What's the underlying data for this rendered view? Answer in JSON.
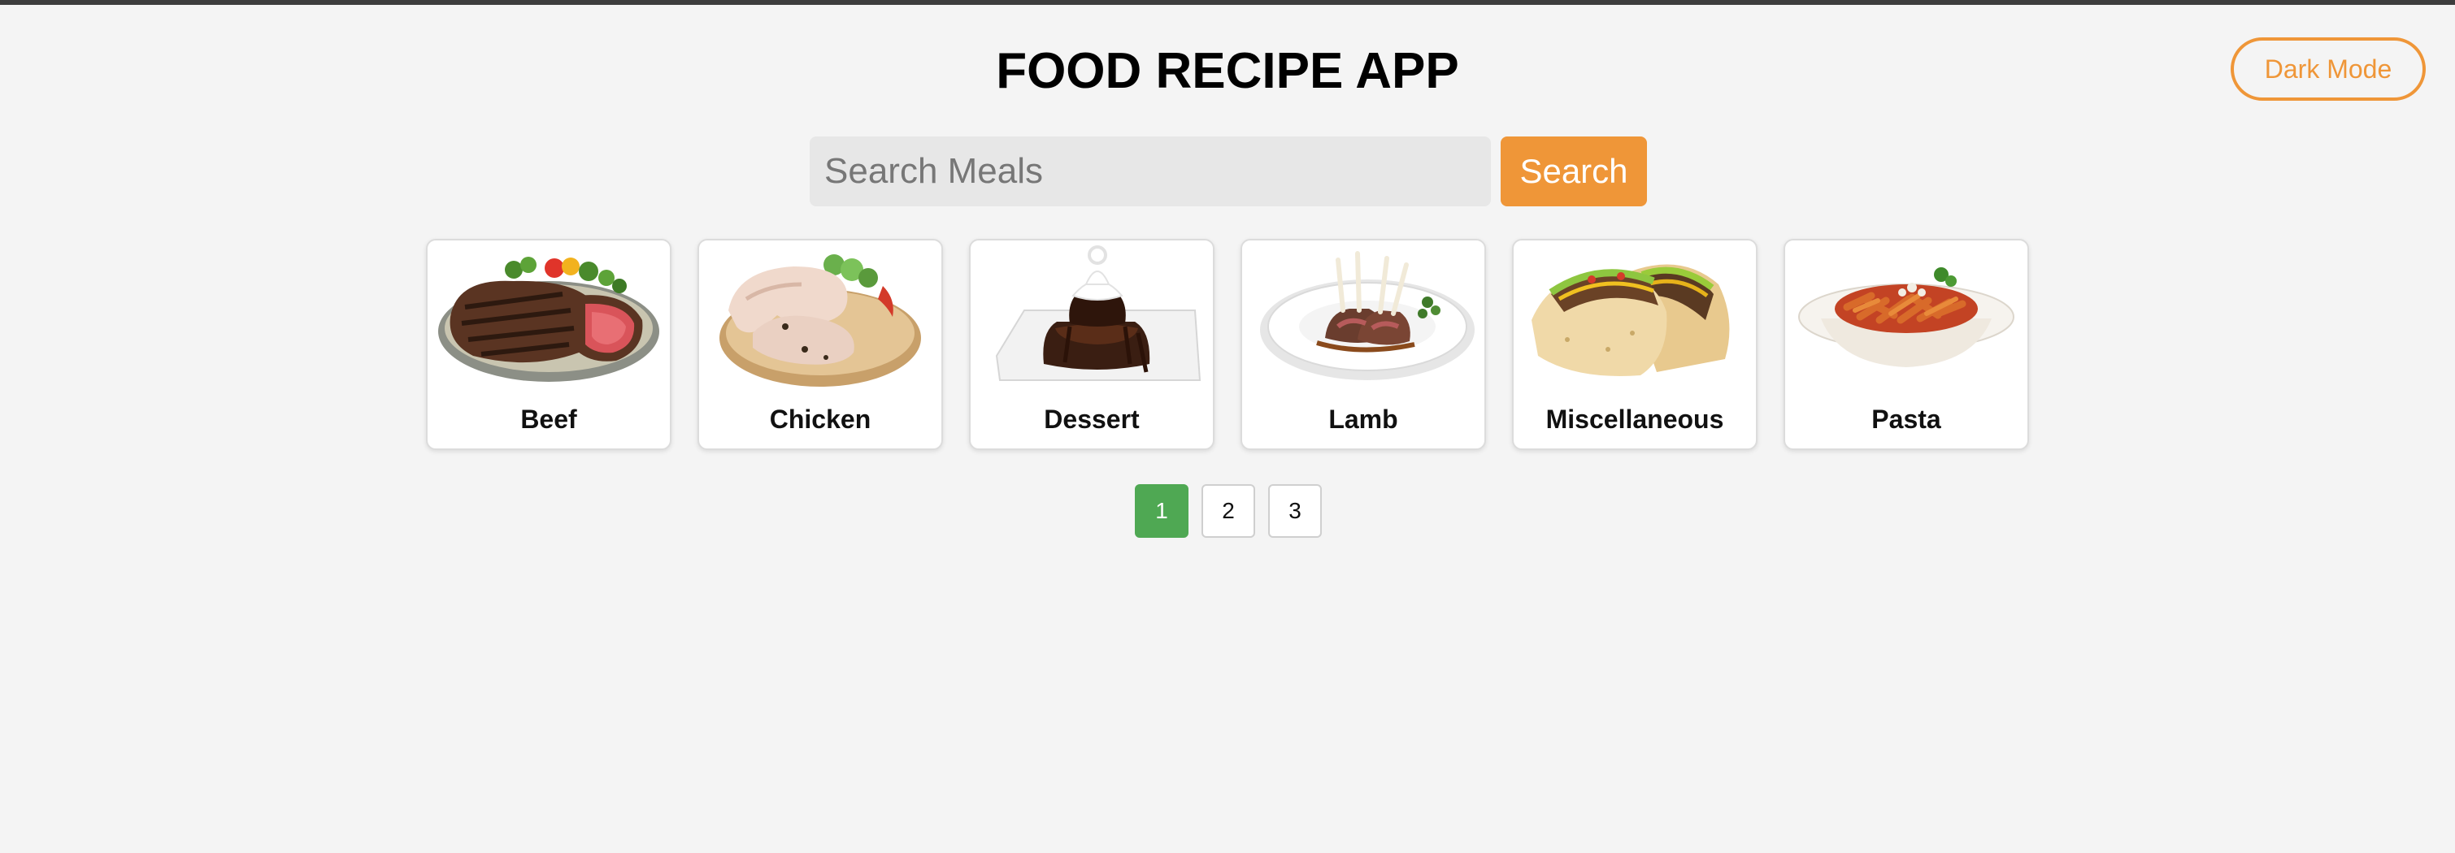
{
  "app": {
    "title": "FOOD RECIPE APP",
    "dark_mode_label": "Dark Mode"
  },
  "search": {
    "placeholder": "Search Meals",
    "value": "",
    "button_label": "Search"
  },
  "categories": [
    {
      "label": "Beef",
      "image": "beef-steak-image"
    },
    {
      "label": "Chicken",
      "image": "chicken-legs-image"
    },
    {
      "label": "Dessert",
      "image": "chocolate-dessert-image"
    },
    {
      "label": "Lamb",
      "image": "lamb-chops-image"
    },
    {
      "label": "Miscellaneous",
      "image": "tacos-image"
    },
    {
      "label": "Pasta",
      "image": "pasta-bowl-image"
    }
  ],
  "pagination": {
    "pages": [
      "1",
      "2",
      "3"
    ],
    "current": "1"
  },
  "colors": {
    "accent": "#ef9638",
    "active_page": "#4fa853",
    "background": "#f4f4f4",
    "top_strip": "#3d3d3d"
  }
}
